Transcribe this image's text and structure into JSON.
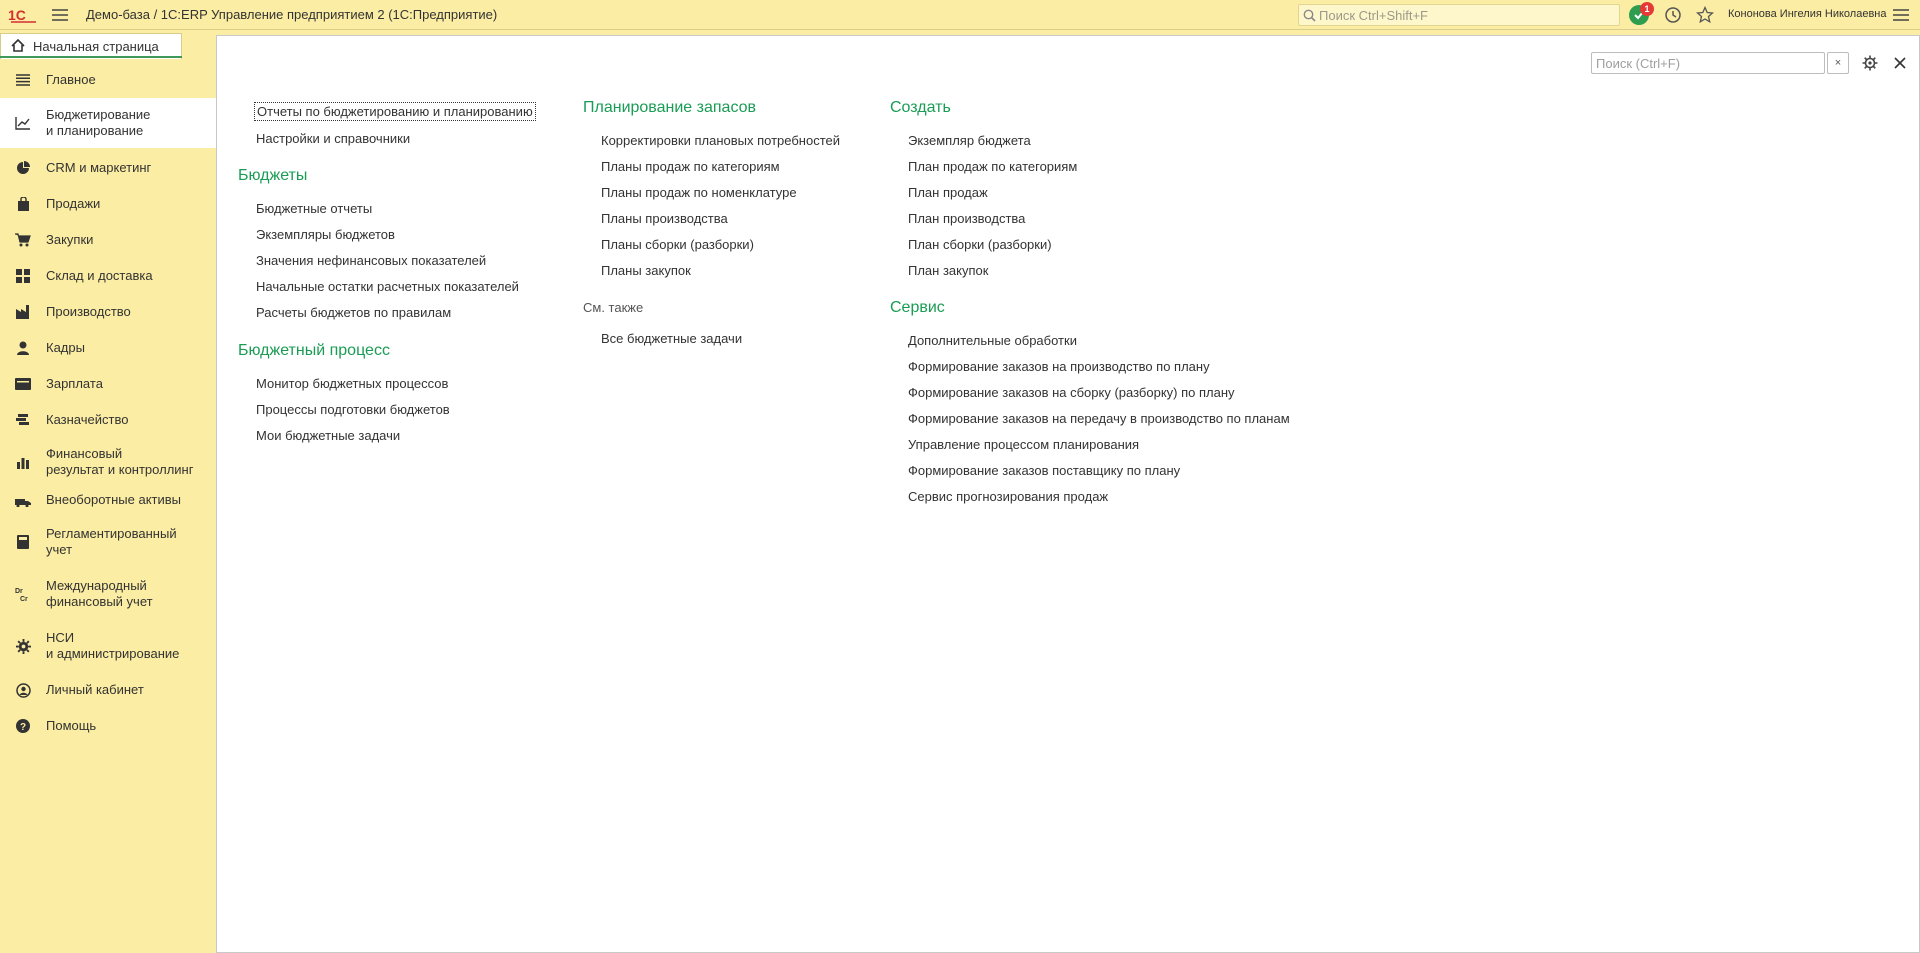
{
  "window": {
    "title": "Демо-база / 1С:ERP Управление предприятием 2  (1С:Предприятие)",
    "search_placeholder": "Поиск Ctrl+Shift+F",
    "notification_count": "1",
    "user": "Кононова Ингелия Николаевна"
  },
  "tabs": {
    "home": "Начальная страница"
  },
  "sidebar": {
    "items": [
      {
        "label": "Главное",
        "icon": "list-icon"
      },
      {
        "label": "Бюджетирование\nи планирование",
        "icon": "budget-chart-icon"
      },
      {
        "label": "CRM и маркетинг",
        "icon": "pie-chart-icon"
      },
      {
        "label": "Продажи",
        "icon": "bag-icon"
      },
      {
        "label": "Закупки",
        "icon": "cart-icon"
      },
      {
        "label": "Склад и доставка",
        "icon": "warehouse-grid-icon"
      },
      {
        "label": "Производство",
        "icon": "factory-icon"
      },
      {
        "label": "Кадры",
        "icon": "person-icon"
      },
      {
        "label": "Зарплата",
        "icon": "wallet-icon"
      },
      {
        "label": "Казначейство",
        "icon": "coins-icon"
      },
      {
        "label": "Финансовый\nрезультат и контроллинг",
        "icon": "bar-chart-icon"
      },
      {
        "label": "Внеоборотные активы",
        "icon": "assets-icon"
      },
      {
        "label": "Регламентированный\nучет",
        "icon": "calculator-icon"
      },
      {
        "label": "Международный\nфинансовый учет",
        "icon": "dr-cr-icon"
      },
      {
        "label": "НСИ\nи администрирование",
        "icon": "gear-icon"
      },
      {
        "label": "Личный кабинет",
        "icon": "user-circle-icon"
      },
      {
        "label": "Помощь",
        "icon": "help-icon"
      }
    ]
  },
  "panel": {
    "search_placeholder": "Поиск (Ctrl+F)",
    "clear_label": "×"
  },
  "columns": {
    "col1": {
      "top_links": [
        "Отчеты по бюджетированию и планированию",
        "Настройки и справочники"
      ],
      "budgets_title": "Бюджеты",
      "budgets_links": [
        "Бюджетные отчеты",
        "Экземпляры бюджетов",
        "Значения нефинансовых показателей",
        "Начальные остатки расчетных показателей",
        "Расчеты бюджетов по правилам"
      ],
      "process_title": "Бюджетный процесс",
      "process_links": [
        "Монитор бюджетных процессов",
        "Процессы подготовки бюджетов",
        "Мои бюджетные задачи"
      ]
    },
    "col2": {
      "title": "Планирование запасов",
      "links": [
        "Корректировки плановых потребностей",
        "Планы продаж по категориям",
        "Планы продаж по номенклатуре",
        "Планы производства",
        "Планы сборки (разборки)",
        "Планы закупок"
      ],
      "see_also_title": "См. также",
      "see_also_links": [
        "Все бюджетные задачи"
      ]
    },
    "col3": {
      "create_title": "Создать",
      "create_links": [
        "Экземпляр бюджета",
        "План продаж по категориям",
        "План продаж",
        "План производства",
        "План сборки (разборки)",
        "План закупок"
      ],
      "service_title": "Сервис",
      "service_links": [
        "Дополнительные обработки",
        "Формирование заказов на производство по плану",
        "Формирование заказов на сборку (разборку) по плану",
        "Формирование заказов на передачу в производство по планам",
        "Управление процессом планирования",
        "Формирование заказов поставщику по плану",
        "Сервис прогнозирования продаж"
      ]
    }
  },
  "colors": {
    "accent_green": "#1a9c55",
    "sidebar_bg": "#fbeda3",
    "badge_red": "#e53935"
  }
}
